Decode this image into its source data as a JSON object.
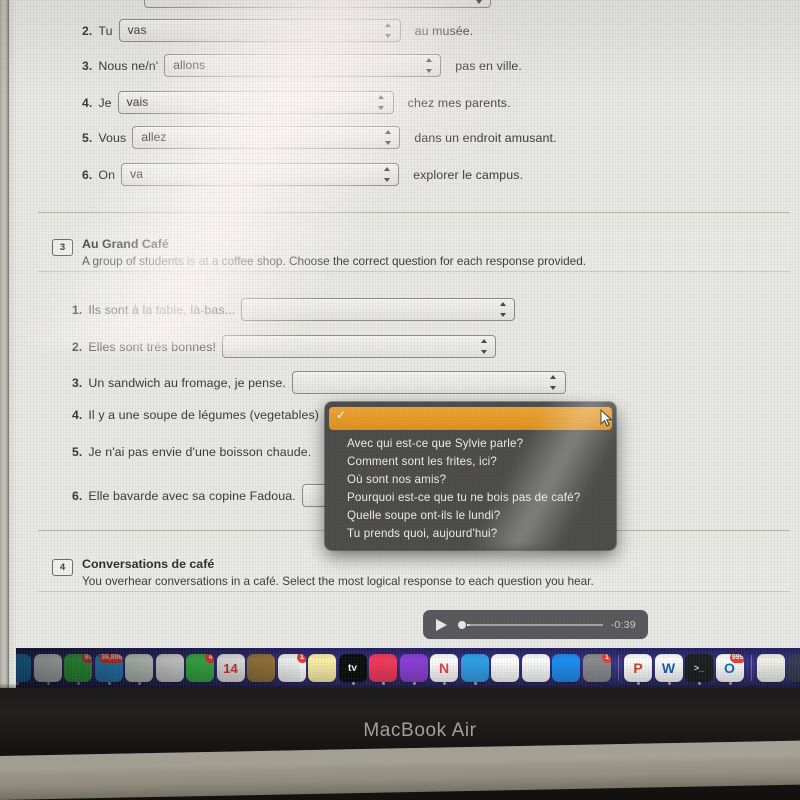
{
  "device": {
    "label": "MacBook Air"
  },
  "exercise2": {
    "items": [
      {
        "num": "2.",
        "before": "Tu",
        "value": "vas",
        "after": "au musée."
      },
      {
        "num": "3.",
        "before": "Nous ne/n'",
        "value": "allons",
        "after": "pas en ville."
      },
      {
        "num": "4.",
        "before": "Je",
        "value": "vais",
        "after": "chez mes parents."
      },
      {
        "num": "5.",
        "before": "Vous",
        "value": "allez",
        "after": "dans un endroit amusant."
      },
      {
        "num": "6.",
        "before": "On",
        "value": "va",
        "after": "explorer le campus."
      }
    ]
  },
  "section3": {
    "badge": "3",
    "title": "Au Grand Café",
    "description": "A group of students is at a coffee shop. Choose the correct question for each response provided.",
    "items": [
      {
        "num": "1.",
        "text": "Ils sont à la table, là-bas...",
        "value": ""
      },
      {
        "num": "2.",
        "text": "Elles sont très bonnes!",
        "value": ""
      },
      {
        "num": "3.",
        "text": "Un sandwich au fromage, je pense.",
        "value": ""
      },
      {
        "num": "4.",
        "text": "Il y a une soupe de légumes (vegetables)",
        "value": ""
      },
      {
        "num": "5.",
        "text": "Je n'ai pas envie d'une boisson chaude.",
        "value": ""
      },
      {
        "num": "6.",
        "text": "Elle bavarde avec sa copine Fadoua.",
        "value": ""
      }
    ]
  },
  "dropdown": {
    "selected_label": "",
    "check_glyph": "✓",
    "highlight_color": "#e8991f",
    "options": [
      "Avec qui est-ce que Sylvie parle?",
      "Comment sont les frites, ici?",
      "Où sont nos amis?",
      "Pourquoi est-ce que tu ne bois pas de café?",
      "Quelle soupe ont-ils le lundi?",
      "Tu prends quoi, aujourd'hui?"
    ]
  },
  "section4": {
    "badge": "4",
    "title": "Conversations de café",
    "description": "You overhear conversations in a café. Select the most logical response to each question you hear."
  },
  "audio_player": {
    "play_label": "Play",
    "time_remaining": "-0:39",
    "progress_percent": 2
  },
  "dock": {
    "items": [
      {
        "name": "finder-icon",
        "glyph": "",
        "bg": "#1f8fe0",
        "badge": "",
        "running": true
      },
      {
        "name": "chrome-icon",
        "glyph": "",
        "bg": "#ffffff",
        "badge": "",
        "running": true
      },
      {
        "name": "messages-icon",
        "glyph": "",
        "bg": "#3cc94c",
        "badge": "95",
        "running": true
      },
      {
        "name": "mail-icon",
        "glyph": "",
        "bg": "#2e9ce8",
        "badge": "36,886",
        "running": true
      },
      {
        "name": "maps-icon",
        "glyph": "",
        "bg": "#eaf4ec",
        "badge": "",
        "running": true
      },
      {
        "name": "photos-icon",
        "glyph": "",
        "bg": "#fbfbfb",
        "badge": "",
        "running": false
      },
      {
        "name": "facetime-icon",
        "glyph": "",
        "bg": "#3ec64d",
        "badge": "4",
        "running": false
      },
      {
        "name": "calendar-icon",
        "glyph": "14",
        "bg": "#ffffff",
        "badge": "",
        "running": false
      },
      {
        "name": "contacts-icon",
        "glyph": "",
        "bg": "#9d7a3b",
        "badge": "",
        "running": false
      },
      {
        "name": "reminders-icon",
        "glyph": "",
        "bg": "#ffffff",
        "badge": "1",
        "running": false
      },
      {
        "name": "notes-icon",
        "glyph": "",
        "bg": "#fdf0a6",
        "badge": "",
        "running": false
      },
      {
        "name": "apple-tv-icon",
        "glyph": "tv",
        "bg": "#0b0b0d",
        "badge": "",
        "running": true
      },
      {
        "name": "music-icon",
        "glyph": "",
        "bg": "#f4375a",
        "badge": "",
        "running": true
      },
      {
        "name": "podcasts-icon",
        "glyph": "",
        "bg": "#8c3cd6",
        "badge": "",
        "running": true
      },
      {
        "name": "news-icon",
        "glyph": "N",
        "bg": "#ffffff",
        "badge": "",
        "running": true
      },
      {
        "name": "keynote-icon",
        "glyph": "",
        "bg": "#2f9fe8",
        "badge": "",
        "running": true
      },
      {
        "name": "numbers-icon",
        "glyph": "",
        "bg": "#ffffff",
        "badge": "",
        "running": false
      },
      {
        "name": "pages-icon",
        "glyph": "",
        "bg": "#fdfdfd",
        "badge": "",
        "running": false
      },
      {
        "name": "app-store-icon",
        "glyph": "",
        "bg": "#1b8cf3",
        "badge": "",
        "running": false
      },
      {
        "name": "system-settings-icon",
        "glyph": "",
        "bg": "#8a8a8f",
        "badge": "1",
        "running": false
      },
      {
        "name": "powerpoint-icon",
        "glyph": "P",
        "bg": "#ffffff",
        "badge": "",
        "running": true
      },
      {
        "name": "word-icon",
        "glyph": "W",
        "bg": "#ffffff",
        "badge": "",
        "running": true
      },
      {
        "name": "terminal-icon",
        "glyph": ">_",
        "bg": "#1d1d1f",
        "badge": "",
        "running": true
      },
      {
        "name": "outlook-icon",
        "glyph": "O",
        "bg": "#ffffff",
        "badge": "999",
        "running": true
      },
      {
        "name": "document-file-icon",
        "glyph": "",
        "bg": "#f2f1ec",
        "badge": "",
        "running": false
      },
      {
        "name": "downloads-stack-icon",
        "glyph": "",
        "bg": "#343a52",
        "badge": "",
        "running": false
      },
      {
        "name": "finder-window-icon",
        "glyph": "",
        "bg": "#3a4260",
        "badge": "",
        "running": false
      },
      {
        "name": "trash-icon",
        "glyph": "",
        "bg": "#3a4260",
        "badge": "",
        "running": false
      }
    ]
  }
}
